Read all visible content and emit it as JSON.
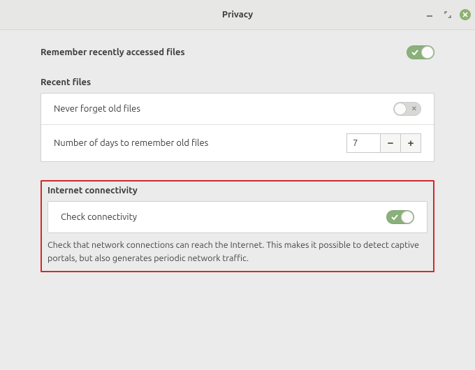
{
  "window": {
    "title": "Privacy"
  },
  "remember_recent": {
    "label": "Remember recently accessed files",
    "enabled": true
  },
  "recent_files": {
    "section_label": "Recent files",
    "never_forget": {
      "label": "Never forget old files",
      "enabled": false
    },
    "days": {
      "label": "Number of days to remember old files",
      "value": "7"
    }
  },
  "internet": {
    "section_label": "Internet connectivity",
    "check": {
      "label": "Check connectivity",
      "enabled": true
    },
    "description": "Check that network connections can reach the Internet. This makes it possible to detect captive portals, but also generates periodic network traffic."
  }
}
